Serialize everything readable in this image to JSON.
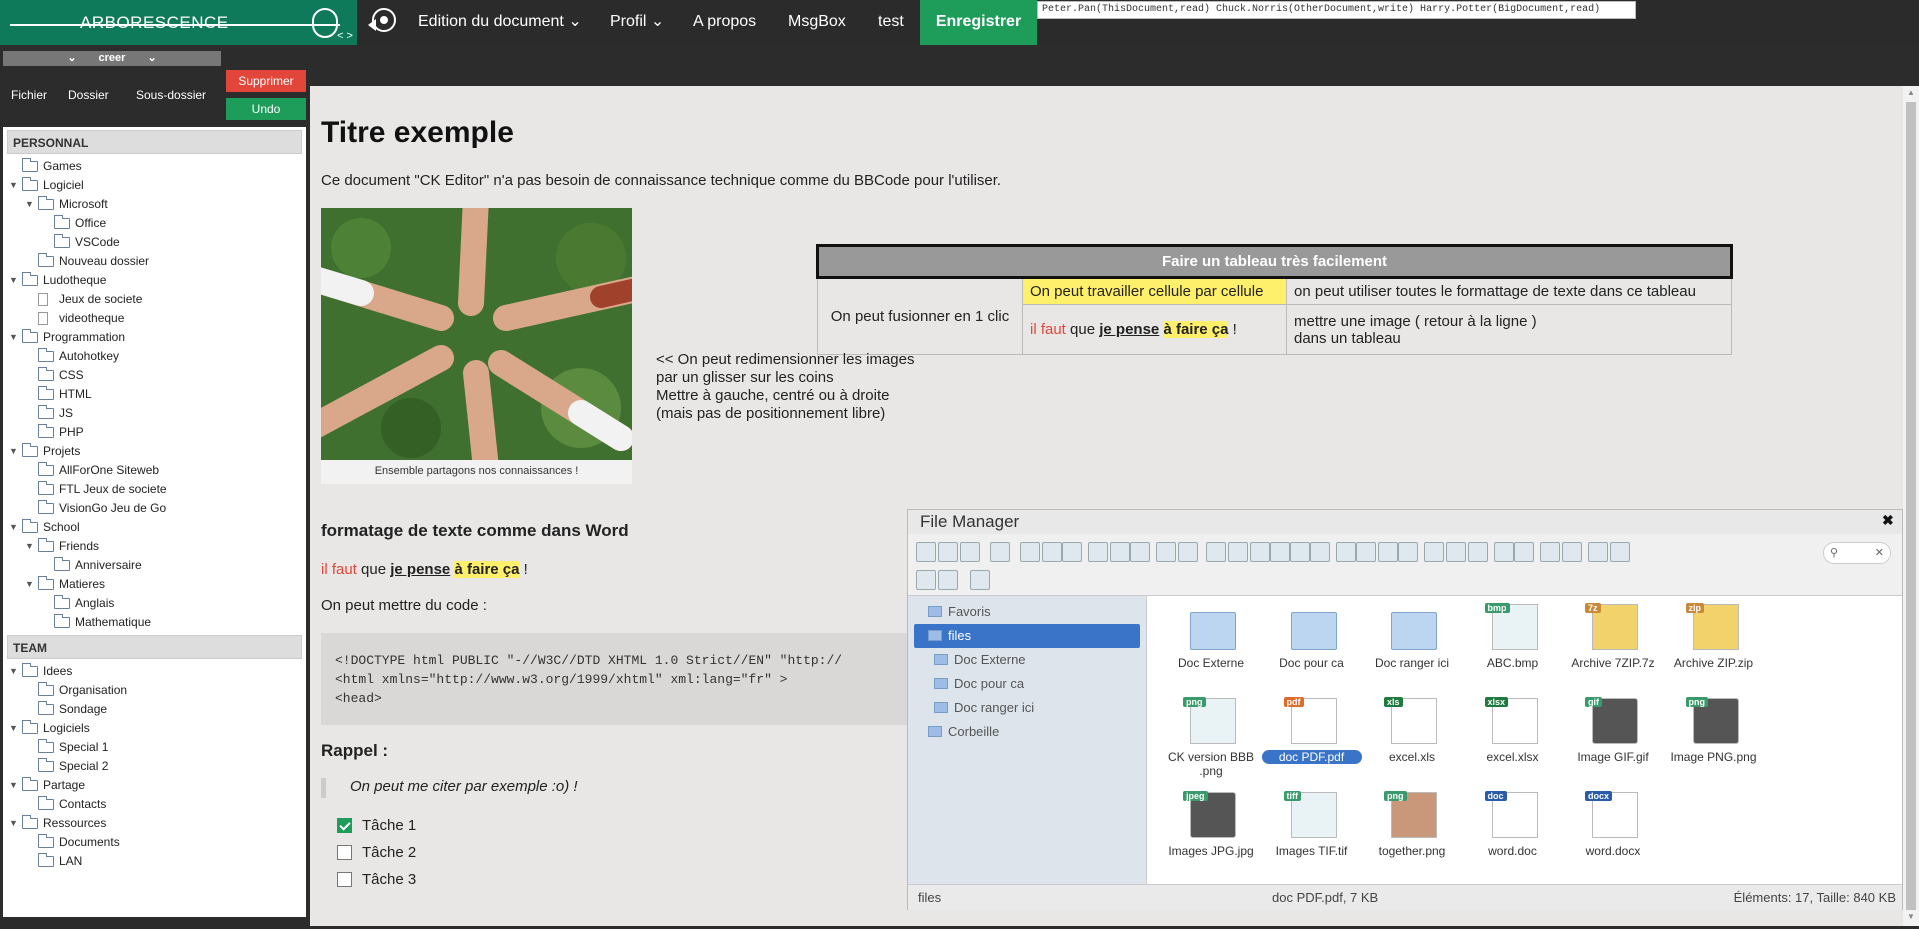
{
  "brand": {
    "title": "ARBORESCENCE",
    "arrows": "< >"
  },
  "nav": {
    "edition": "Edition du document",
    "profil": "Profil",
    "apropos": "A propos",
    "msgbox": "MsgBox",
    "test": "test",
    "save": "Enregistrer"
  },
  "permissions": "Peter.Pan(ThisDocument,read) Chuck.Norris(OtherDocument,write) Harry.Potter(BigDocument,read)",
  "left": {
    "creer": "creer",
    "fichier": "Fichier",
    "dossier": "Dossier",
    "sousdossier": "Sous-dossier",
    "supprimer": "Supprimer",
    "undo": "Undo"
  },
  "tree": {
    "personal_title": "PERSONNAL",
    "personal": [
      {
        "label": "Games",
        "level": 1,
        "toggle": ""
      },
      {
        "label": "Logiciel",
        "level": 1,
        "toggle": "▼"
      },
      {
        "label": "Microsoft",
        "level": 2,
        "toggle": "▼"
      },
      {
        "label": "Office",
        "level": 3,
        "toggle": ""
      },
      {
        "label": "VSCode",
        "level": 3,
        "toggle": ""
      },
      {
        "label": "Nouveau dossier",
        "level": 2,
        "toggle": ""
      },
      {
        "label": "Ludotheque",
        "level": 1,
        "toggle": "▼"
      },
      {
        "label": "Jeux de societe",
        "level": 2,
        "toggle": "",
        "doc": true
      },
      {
        "label": "videotheque",
        "level": 2,
        "toggle": "",
        "doc": true
      },
      {
        "label": "Programmation",
        "level": 1,
        "toggle": "▼"
      },
      {
        "label": "Autohotkey",
        "level": 2,
        "toggle": ""
      },
      {
        "label": "CSS",
        "level": 2,
        "toggle": ""
      },
      {
        "label": "HTML",
        "level": 2,
        "toggle": ""
      },
      {
        "label": "JS",
        "level": 2,
        "toggle": ""
      },
      {
        "label": "PHP",
        "level": 2,
        "toggle": ""
      },
      {
        "label": "Projets",
        "level": 1,
        "toggle": "▼"
      },
      {
        "label": "AllForOne Siteweb",
        "level": 2,
        "toggle": ""
      },
      {
        "label": "FTL Jeux de societe",
        "level": 2,
        "toggle": ""
      },
      {
        "label": "VisionGo Jeu de Go",
        "level": 2,
        "toggle": ""
      },
      {
        "label": "School",
        "level": 1,
        "toggle": "▼"
      },
      {
        "label": "Friends",
        "level": 2,
        "toggle": "▼"
      },
      {
        "label": "Anniversaire",
        "level": 3,
        "toggle": ""
      },
      {
        "label": "Matieres",
        "level": 2,
        "toggle": "▼"
      },
      {
        "label": "Anglais",
        "level": 3,
        "toggle": ""
      },
      {
        "label": "Mathematique",
        "level": 3,
        "toggle": ""
      }
    ],
    "team_title": "TEAM",
    "team": [
      {
        "label": "Idees",
        "level": 1,
        "toggle": "▼"
      },
      {
        "label": "Organisation",
        "level": 2,
        "toggle": ""
      },
      {
        "label": "Sondage",
        "level": 2,
        "toggle": ""
      },
      {
        "label": "Logiciels",
        "level": 1,
        "toggle": "▼"
      },
      {
        "label": "Special 1",
        "level": 2,
        "toggle": ""
      },
      {
        "label": "Special 2",
        "level": 2,
        "toggle": ""
      },
      {
        "label": "Partage",
        "level": 1,
        "toggle": "▼"
      },
      {
        "label": "Contacts",
        "level": 2,
        "toggle": ""
      },
      {
        "label": "Ressources",
        "level": 1,
        "toggle": "▼"
      },
      {
        "label": "Documents",
        "level": 2,
        "toggle": ""
      },
      {
        "label": "LAN",
        "level": 2,
        "toggle": ""
      }
    ]
  },
  "doc": {
    "title": "Titre exemple",
    "intro": "Ce document \"CK Editor\" n'a pas besoin de connaissance technique comme du BBCode pour l'utiliser.",
    "caption": "Ensemble partagons nos connaissances !",
    "resize_lines": [
      "<< On peut redimensionner les images",
      "par un glisser sur les coins",
      "Mettre à gauche, centré ou à droite",
      "(mais pas de positionnement libre)"
    ],
    "table": {
      "header": "Faire un tableau très facilement",
      "merge": "On peut fusionner en 1 clic",
      "cell_yellow": "On peut travailler cellule par cellule",
      "cell_format": "on peut utiliser toutes le formattage de texte dans ce tableau",
      "rich": {
        "a": "il faut",
        "b": " que ",
        "c": "je pense",
        "d": " ",
        "e": "à faire ça",
        "f": " !"
      },
      "image_line1": "mettre une image ( retour à la ligne )",
      "image_line2": "dans un tableau"
    },
    "h_format": "formatage de texte comme dans Word",
    "rich": {
      "a": "il faut",
      "b": " que ",
      "c": "je pense",
      "d": " ",
      "e": "à faire ça",
      "f": " !"
    },
    "code_intro": "On peut mettre du code :",
    "code": "<!DOCTYPE html PUBLIC \"-//W3C//DTD XHTML 1.0 Strict//EN\" \"http://\n<html xmlns=\"http://www.w3.org/1999/xhtml\" xml:lang=\"fr\" >\n<head>",
    "h_rappel": "Rappel :",
    "quote": "On peut me citer par exemple :o) !",
    "tasks": [
      {
        "label": "Tâche 1",
        "done": true
      },
      {
        "label": "Tâche 2",
        "done": false
      },
      {
        "label": "Tâche 3",
        "done": false
      }
    ]
  },
  "filemanager": {
    "title": "File Manager",
    "search_icon": "search-icon",
    "sidebar": [
      {
        "label": "Favoris",
        "level": 1,
        "selected": false
      },
      {
        "label": "files",
        "level": 1,
        "selected": true
      },
      {
        "label": "Doc Externe",
        "level": 2,
        "selected": false
      },
      {
        "label": "Doc pour ca",
        "level": 2,
        "selected": false
      },
      {
        "label": "Doc ranger ici",
        "level": 2,
        "selected": false
      },
      {
        "label": "Corbeille",
        "level": 1,
        "selected": false
      }
    ],
    "files": [
      {
        "name": "Doc Externe",
        "kind": "folder",
        "tag": ""
      },
      {
        "name": "Doc pour ca",
        "kind": "folder",
        "tag": ""
      },
      {
        "name": "Doc ranger ici",
        "kind": "folder",
        "tag": ""
      },
      {
        "name": "ABC.bmp",
        "kind": "img",
        "tag": "bmp"
      },
      {
        "name": "Archive 7ZIP.7z",
        "kind": "zip",
        "tag": "7z"
      },
      {
        "name": "Archive ZIP.zip",
        "kind": "zip",
        "tag": "zip"
      },
      {
        "name": "CK version BBB .png",
        "kind": "img",
        "tag": "png"
      },
      {
        "name": "doc PDF.pdf",
        "kind": "pdf",
        "tag": "pdf",
        "selected": true
      },
      {
        "name": "excel.xls",
        "kind": "xls",
        "tag": "xls"
      },
      {
        "name": "excel.xlsx",
        "kind": "xls",
        "tag": "xlsx"
      },
      {
        "name": "Image GIF.gif",
        "kind": "dark",
        "tag": "gif"
      },
      {
        "name": "Image PNG.png",
        "kind": "dark",
        "tag": "png"
      },
      {
        "name": "Images JPG.jpg",
        "kind": "dark",
        "tag": "jpeg"
      },
      {
        "name": "Images TIF.tif",
        "kind": "img",
        "tag": "tiff"
      },
      {
        "name": "together.png",
        "kind": "photo",
        "tag": "png"
      },
      {
        "name": "word.doc",
        "kind": "word",
        "tag": "doc"
      },
      {
        "name": "word.docx",
        "kind": "word",
        "tag": "docx"
      }
    ],
    "status": {
      "path": "files",
      "selected": "doc PDF.pdf, 7 KB",
      "summary": "Éléments: 17, Taille: 840 KB"
    }
  },
  "colors": {
    "brand": "#0f7a5a",
    "save": "#1e9c5a",
    "danger": "#e2463a",
    "select": "#3a74c9",
    "highlight": "#fff06b"
  }
}
